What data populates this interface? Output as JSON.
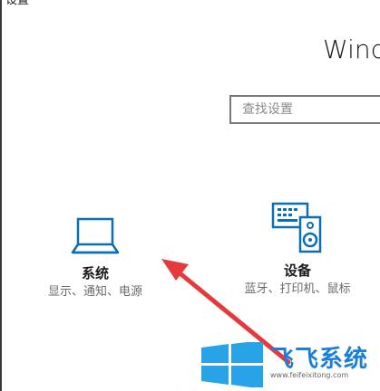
{
  "window": {
    "title": "设置"
  },
  "header": {
    "heading_partial": "Windo"
  },
  "search": {
    "placeholder": "查找设置"
  },
  "tiles": [
    {
      "id": "system",
      "title": "系统",
      "description": "显示、通知、电源",
      "icon": "laptop-icon"
    },
    {
      "id": "devices",
      "title": "设备",
      "description": "蓝牙、打印机、鼠标",
      "icon": "keyboard-speaker-icon"
    }
  ],
  "watermark": {
    "brand": "飞飞系统",
    "url": "www.feifeixitong.com"
  },
  "colors": {
    "accent": "#0a6fb5",
    "arrow": "#e5393b",
    "watermark_blue": "#1a7fd8",
    "text_secondary": "#6a6a6a"
  }
}
